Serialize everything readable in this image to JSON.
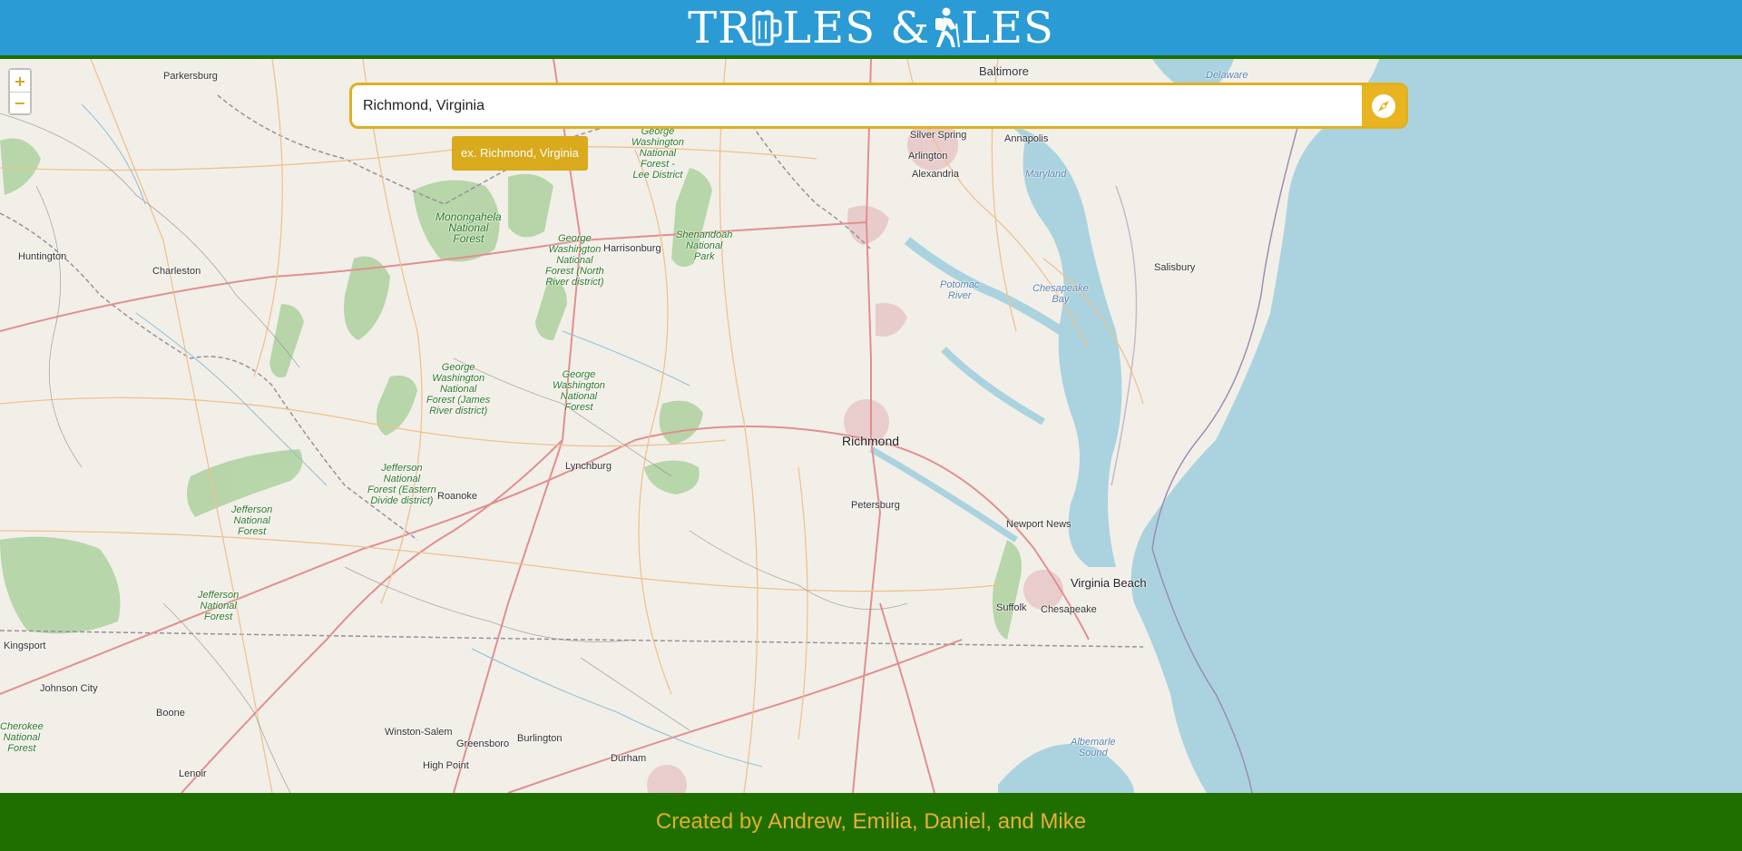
{
  "header": {
    "brand_part1": "TR",
    "brand_part2": "LES & ",
    "brand_part3": "LES",
    "icon_1": "beer-mug-icon",
    "icon_2": "hiker-icon"
  },
  "zoom": {
    "in_label": "+",
    "out_label": "−"
  },
  "search": {
    "value": "Richmond, Virginia",
    "suggestion": "ex. Richmond, Virginia",
    "button_icon": "compass-icon"
  },
  "map": {
    "cities": [
      "Parkersburg",
      "Baltimore",
      "Silver Spring",
      "Annapolis",
      "Arlington",
      "Alexandria",
      "Huntington",
      "Charleston",
      "Harrisonburg",
      "Salisbury",
      "Richmond",
      "Lynchburg",
      "Roanoke",
      "Petersburg",
      "Newport News",
      "Virginia Beach",
      "Suffolk",
      "Chesapeake",
      "Kingsport",
      "Johnson City",
      "Boone",
      "Winston-Salem",
      "Greensboro",
      "Burlington",
      "High Point",
      "Durham",
      "Lenoir"
    ],
    "forests": [
      "George\nWashington\nNational\nForest -\nLee District",
      "Monongahela\nNational\nForest",
      "George\nWashington\nNational\nForest (North\nRiver district)",
      "Shenandoah\nNational\nPark",
      "George\nWashington\nNational\nForest (James\nRiver district)",
      "George\nWashington\nNational\nForest",
      "Jefferson\nNational\nForest (Eastern\nDivide district)",
      "Jefferson\nNational\nForest",
      "Jefferson\nNational\nForest",
      "Cherokee\nNational\nForest"
    ],
    "water": [
      "Delaware",
      "Maryland",
      "Potomac\nRiver",
      "Chesapeake\nBay",
      "Albemarle\nSound"
    ]
  },
  "footer": {
    "prefix": "Created by",
    "names": "Andrew, Emilia, Daniel, and Mike"
  },
  "colors": {
    "header_bg": "#2b9bd6",
    "footer_bg": "#1f6e00",
    "accent": "#e0b020",
    "water": "#aad3df",
    "land": "#f2efe9"
  }
}
